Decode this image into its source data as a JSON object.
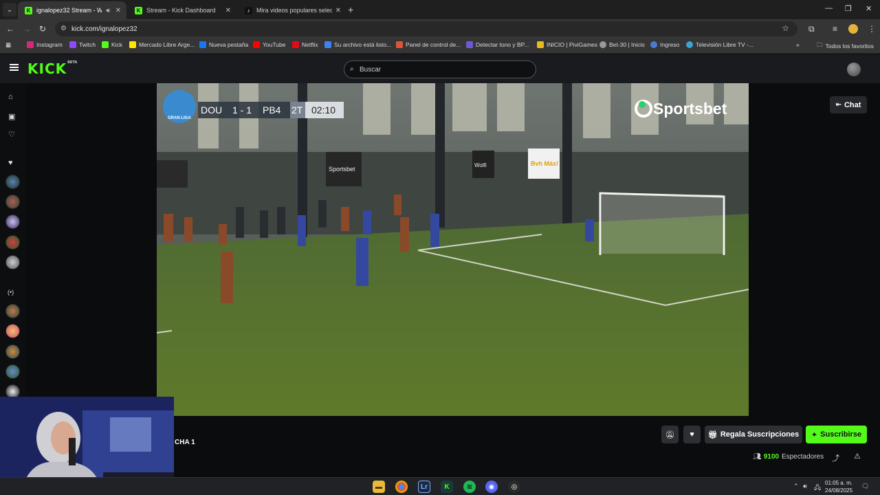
{
  "browser": {
    "tabs": [
      {
        "title": "ignalopez32 Stream - Watch",
        "favicon": "K",
        "active": true
      },
      {
        "title": "Stream - Kick Dashboard",
        "favicon": "K",
        "active": false
      },
      {
        "title": "Mira videos populares seleccio",
        "favicon": "tiktok",
        "active": false
      }
    ],
    "url": "kick.com/ignalopez32",
    "bookmarks": [
      {
        "label": "Instagram",
        "color": "#d6287a"
      },
      {
        "label": "Twitch",
        "color": "#9146ff"
      },
      {
        "label": "Kick",
        "color": "#53fc18"
      },
      {
        "label": "Mercado Libre Arge...",
        "color": "#ffe600"
      },
      {
        "label": "Nueva pestaña",
        "color": "#1877f2"
      },
      {
        "label": "YouTube",
        "color": "#ff0000"
      },
      {
        "label": "Netflix",
        "color": "#e50914"
      },
      {
        "label": "Su archivo está listo...",
        "color": "#3b82f6"
      },
      {
        "label": "Panel de control de...",
        "color": "#e0523a"
      },
      {
        "label": "Detectar tono y BP...",
        "color": "#6b5bd2"
      },
      {
        "label": "INICIO | PiviGames",
        "color": "#e8b923"
      },
      {
        "label": "Bet-30 | Inicio",
        "color": "#999999"
      },
      {
        "label": "Ingreso",
        "color": "#4a7bd0"
      },
      {
        "label": "Televisión Libre TV -...",
        "color": "#3ba3d8"
      }
    ],
    "all_bookmarks_label": "Todos los favoritos"
  },
  "kick": {
    "logo": "KICK",
    "logo_badge": "BETA",
    "search_placeholder": "Buscar",
    "chat_label": "Chat",
    "stream_title_fragment": "CHA 1",
    "gift_label": "Regala Suscripciones",
    "subscribe_label": "Suscribirse",
    "viewer_count": "9100",
    "viewers_label": "Espectadores",
    "accent": "#53fc18"
  },
  "video": {
    "score_home": "DOU",
    "score": "1 - 1",
    "score_away": "PB4",
    "period": "2T",
    "clock": "02:10",
    "league": "GRAN LIGA",
    "sponsor": "Sportsbet",
    "banner_1": "Sportsbet",
    "banner_2": "Wolfi",
    "banner_3": "Bvh Más!"
  },
  "taskbar": {
    "time": "01:05 a. m.",
    "date": "24/08/2025"
  }
}
